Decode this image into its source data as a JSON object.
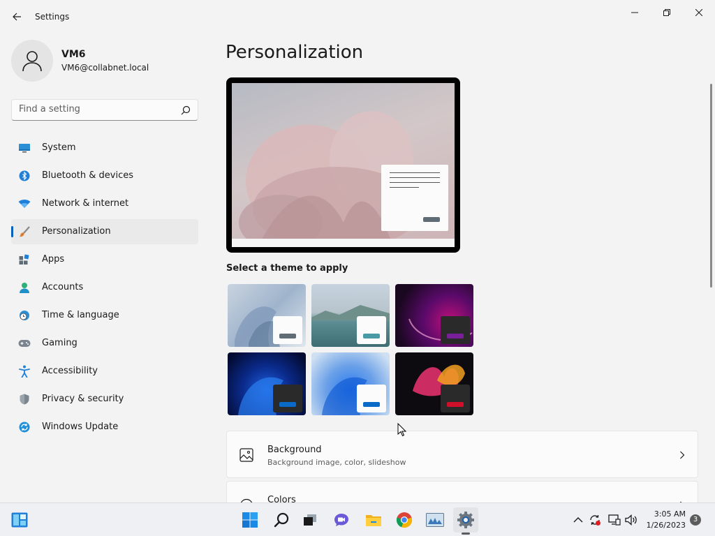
{
  "app": {
    "title": "Settings"
  },
  "user": {
    "name": "VM6",
    "email": "VM6@collabnet.local"
  },
  "search": {
    "placeholder": "Find a setting"
  },
  "sidebar": {
    "items": [
      {
        "label": "System",
        "icon": "monitor-icon"
      },
      {
        "label": "Bluetooth & devices",
        "icon": "bluetooth-icon"
      },
      {
        "label": "Network & internet",
        "icon": "wifi-icon"
      },
      {
        "label": "Personalization",
        "icon": "brush-icon",
        "active": true
      },
      {
        "label": "Apps",
        "icon": "apps-icon"
      },
      {
        "label": "Accounts",
        "icon": "person-icon"
      },
      {
        "label": "Time & language",
        "icon": "clock-globe-icon"
      },
      {
        "label": "Gaming",
        "icon": "gamepad-icon"
      },
      {
        "label": "Accessibility",
        "icon": "accessibility-icon"
      },
      {
        "label": "Privacy & security",
        "icon": "shield-icon"
      },
      {
        "label": "Windows Update",
        "icon": "update-icon"
      }
    ]
  },
  "main": {
    "title": "Personalization",
    "themes_label": "Select a theme to apply",
    "themes": [
      {
        "name": "theme-1",
        "accent": "#5f6b75"
      },
      {
        "name": "theme-2",
        "accent": "#4a9aa5"
      },
      {
        "name": "theme-3",
        "accent": "#7a1f9a"
      },
      {
        "name": "theme-4",
        "accent": "#0a6ac8"
      },
      {
        "name": "theme-5",
        "accent": "#0a6ac8"
      },
      {
        "name": "theme-6",
        "accent": "#d0102a"
      }
    ],
    "rows": [
      {
        "title": "Background",
        "subtitle": "Background image, color, slideshow",
        "icon": "image-icon"
      },
      {
        "title": "Colors",
        "subtitle": "",
        "icon": "palette-icon"
      }
    ]
  },
  "taskbar": {
    "time": "3:05 AM",
    "date": "1/26/2023",
    "notification_count": "3"
  },
  "colors": {
    "accent": "#005fb8",
    "background": "#f3f3f3"
  }
}
